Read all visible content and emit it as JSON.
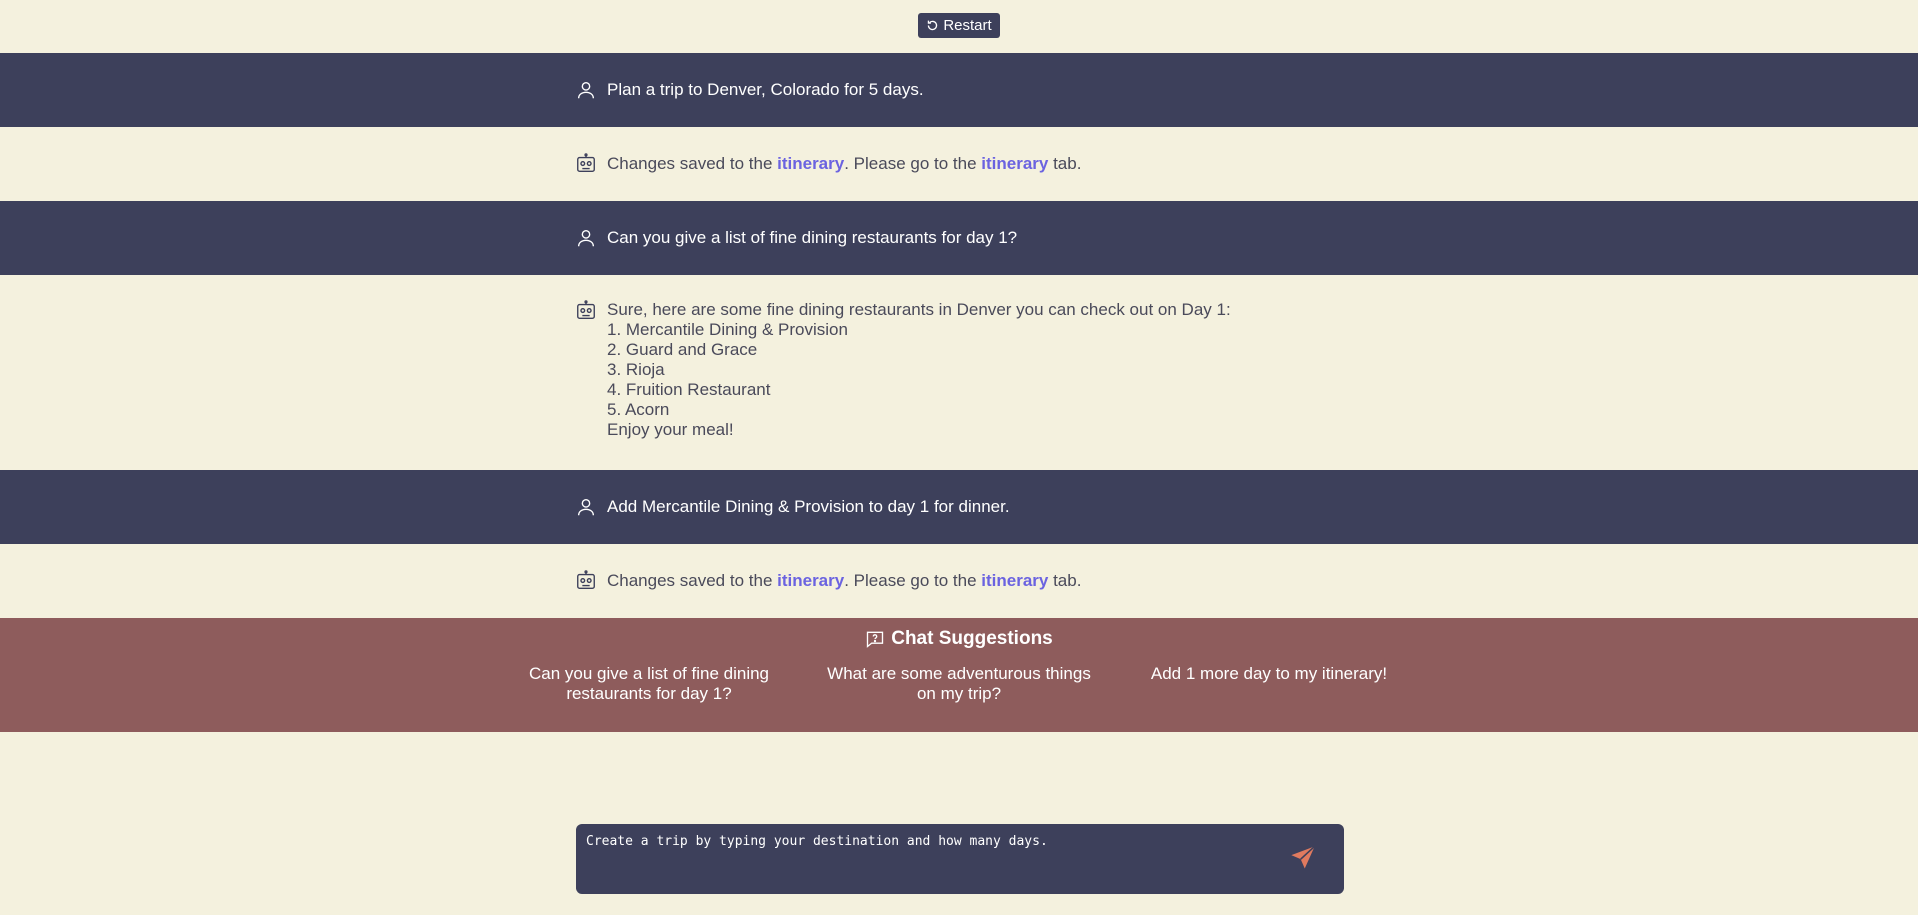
{
  "toolbar": {
    "restart_label": "Restart"
  },
  "messages": [
    {
      "role": "user",
      "text": "Plan a trip to Denver, Colorado for 5 days."
    },
    {
      "role": "bot",
      "pre": "Changes saved to the ",
      "link1": "itinerary",
      "mid": ". Please go to the ",
      "link2": "itinerary",
      "post": " tab."
    },
    {
      "role": "user",
      "text": "Can you give a list of fine dining restaurants for day 1?"
    },
    {
      "role": "bot",
      "lines": [
        "Sure, here are some fine dining restaurants in Denver you can check out on Day 1:",
        "1. Mercantile Dining & Provision",
        "2. Guard and Grace",
        "3. Rioja",
        "4. Fruition Restaurant",
        "5. Acorn",
        "Enjoy your meal!"
      ]
    },
    {
      "role": "user",
      "text": "Add Mercantile Dining & Provision to day 1 for dinner."
    },
    {
      "role": "bot",
      "pre": "Changes saved to the ",
      "link1": "itinerary",
      "mid": ". Please go to the ",
      "link2": "itinerary",
      "post": " tab."
    }
  ],
  "suggestions": {
    "title": "Chat Suggestions",
    "items": [
      "Can you give a list of fine dining restaurants for day 1?",
      "What are some adventurous things on my trip?",
      "Add 1 more day to my itinerary!"
    ]
  },
  "composer": {
    "placeholder": "Create a trip by typing your destination and how many days."
  },
  "colors": {
    "background": "#f4f1de",
    "user_row": "#3d405b",
    "suggestions_bg": "#8e5c5c",
    "link": "#6b63e0",
    "send_icon": "#e07a5f"
  },
  "icons": {
    "restart": "restart-icon",
    "user": "user-icon",
    "bot": "robot-icon",
    "suggestions": "chat-question-icon",
    "send": "send-icon"
  }
}
